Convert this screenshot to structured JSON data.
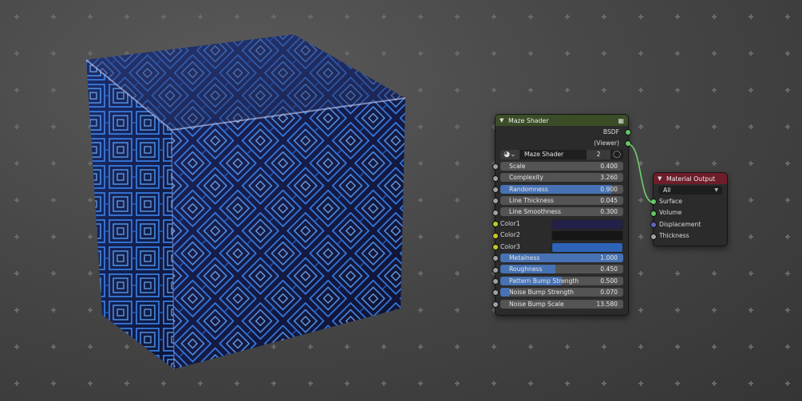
{
  "maze_node": {
    "title": "Maze Shader",
    "outputs": [
      "BSDF",
      "(Viewer)"
    ],
    "node_group": {
      "name": "Maze Shader",
      "users": "2"
    },
    "params": [
      {
        "label": "Scale",
        "value": "0.400",
        "fill": 0
      },
      {
        "label": "Complexity",
        "value": "3.260",
        "fill": 0
      },
      {
        "label": "Randomness",
        "value": "0.900",
        "fill": 0.9
      },
      {
        "label": "Line Thickness",
        "value": "0.045",
        "fill": 0
      },
      {
        "label": "Line Smoothness",
        "value": "0.300",
        "fill": 0
      }
    ],
    "colors": [
      {
        "label": "Color1",
        "hex": "#23214a"
      },
      {
        "label": "Color2",
        "hex": "#161616"
      },
      {
        "label": "Color3",
        "hex": "#2e63b8"
      }
    ],
    "params2": [
      {
        "label": "Metalness",
        "value": "1.000",
        "fill": 1.0
      },
      {
        "label": "Roughness",
        "value": "0.450",
        "fill": 0.45
      },
      {
        "label": "Pattern Bump Strength",
        "value": "0.500",
        "fill": 0.5
      },
      {
        "label": "Noise Bump Strength",
        "value": "0.070",
        "fill": 0.07
      },
      {
        "label": "Noise Bump Scale",
        "value": "13.580",
        "fill": 0
      }
    ],
    "header_color": "#3b4d26"
  },
  "output_node": {
    "title": "Material Output",
    "target": "All",
    "inputs": [
      "Surface",
      "Volume",
      "Displacement",
      "Thickness"
    ],
    "header_color": "#6e1d2a"
  },
  "colors": {
    "accent_fill": "#4772b3",
    "link_wire": "#6fd06f"
  }
}
